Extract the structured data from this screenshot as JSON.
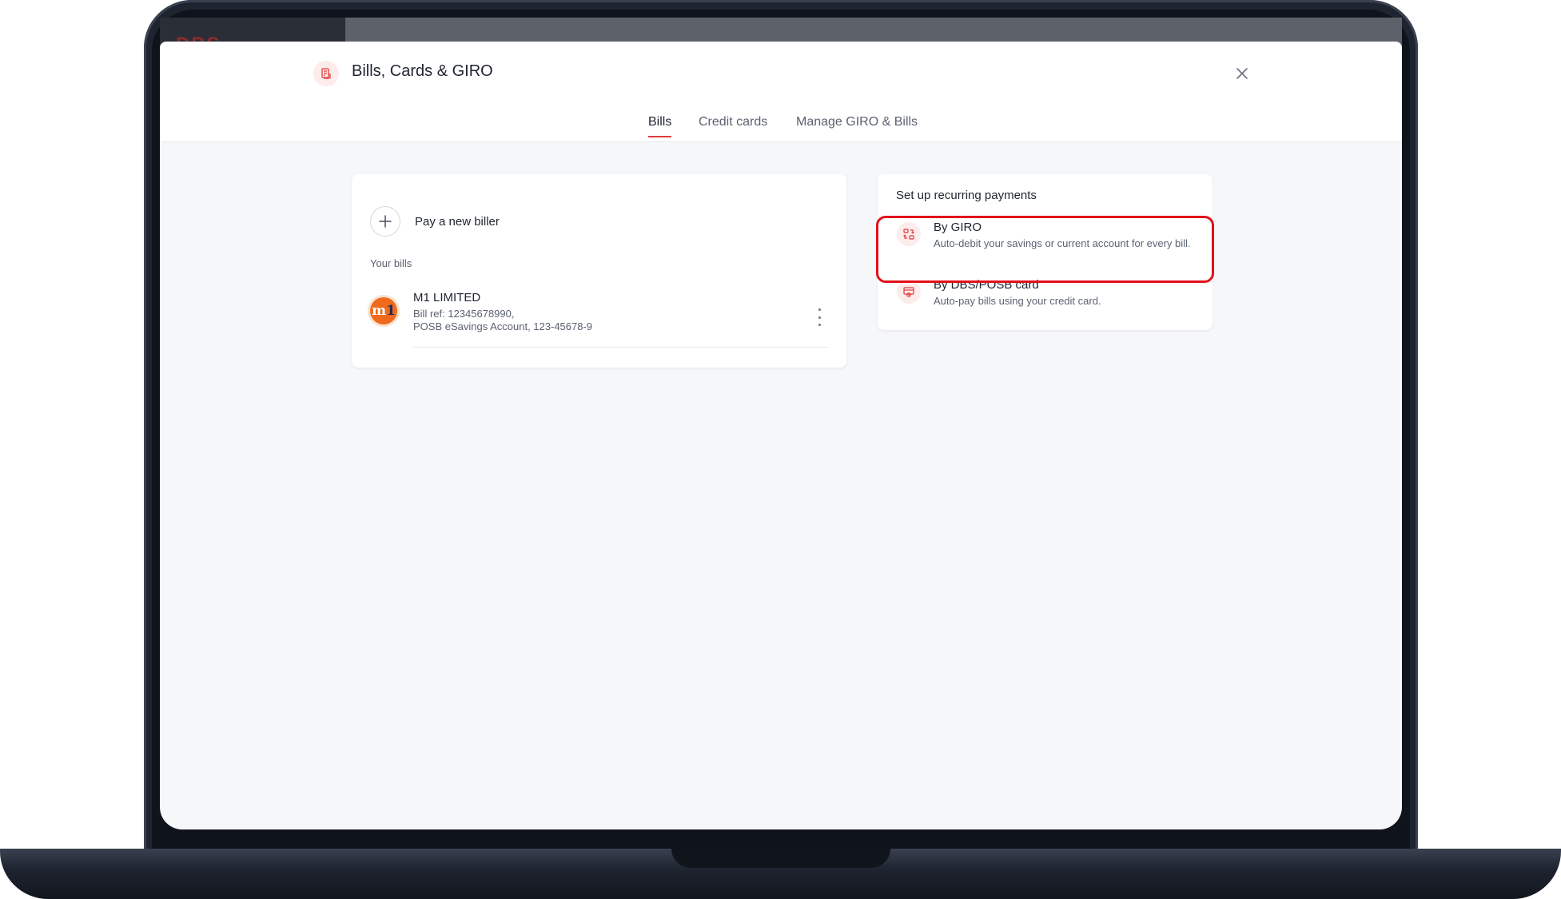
{
  "background_app": {
    "logo_text": "DBS"
  },
  "header": {
    "title": "Bills, Cards & GIRO",
    "title_icon": "receipt-icon",
    "close_icon": "close-icon"
  },
  "tabs": [
    {
      "label": "Bills",
      "active": true
    },
    {
      "label": "Credit cards",
      "active": false
    },
    {
      "label": "Manage GIRO & Bills",
      "active": false
    }
  ],
  "bills_card": {
    "add_label": "Pay a new biller",
    "add_icon": "plus-icon",
    "section_label": "Your bills",
    "bills": [
      {
        "name": "M1 LIMITED",
        "logo_text": "m",
        "logo_text_accent": "1",
        "ref_line": "Bill ref: 12345678990,",
        "account_line": "POSB eSavings Account, 123-45678-9",
        "menu_icon": "more-vertical-icon"
      }
    ]
  },
  "recurring_card": {
    "heading": "Set up recurring payments",
    "options": [
      {
        "title": "By GIRO",
        "description": "Auto-debit your savings or current account for every bill.",
        "icon": "giro-transfer-icon",
        "highlighted": true
      },
      {
        "title": "By DBS/POSB card",
        "description": "Auto-pay bills using your credit card.",
        "icon": "card-payment-icon",
        "highlighted": false
      }
    ]
  },
  "colors": {
    "accent": "#e23a3a",
    "highlight": "#e3101a",
    "icon_bg": "#fdecec",
    "page_bg": "#f6f7f9"
  }
}
